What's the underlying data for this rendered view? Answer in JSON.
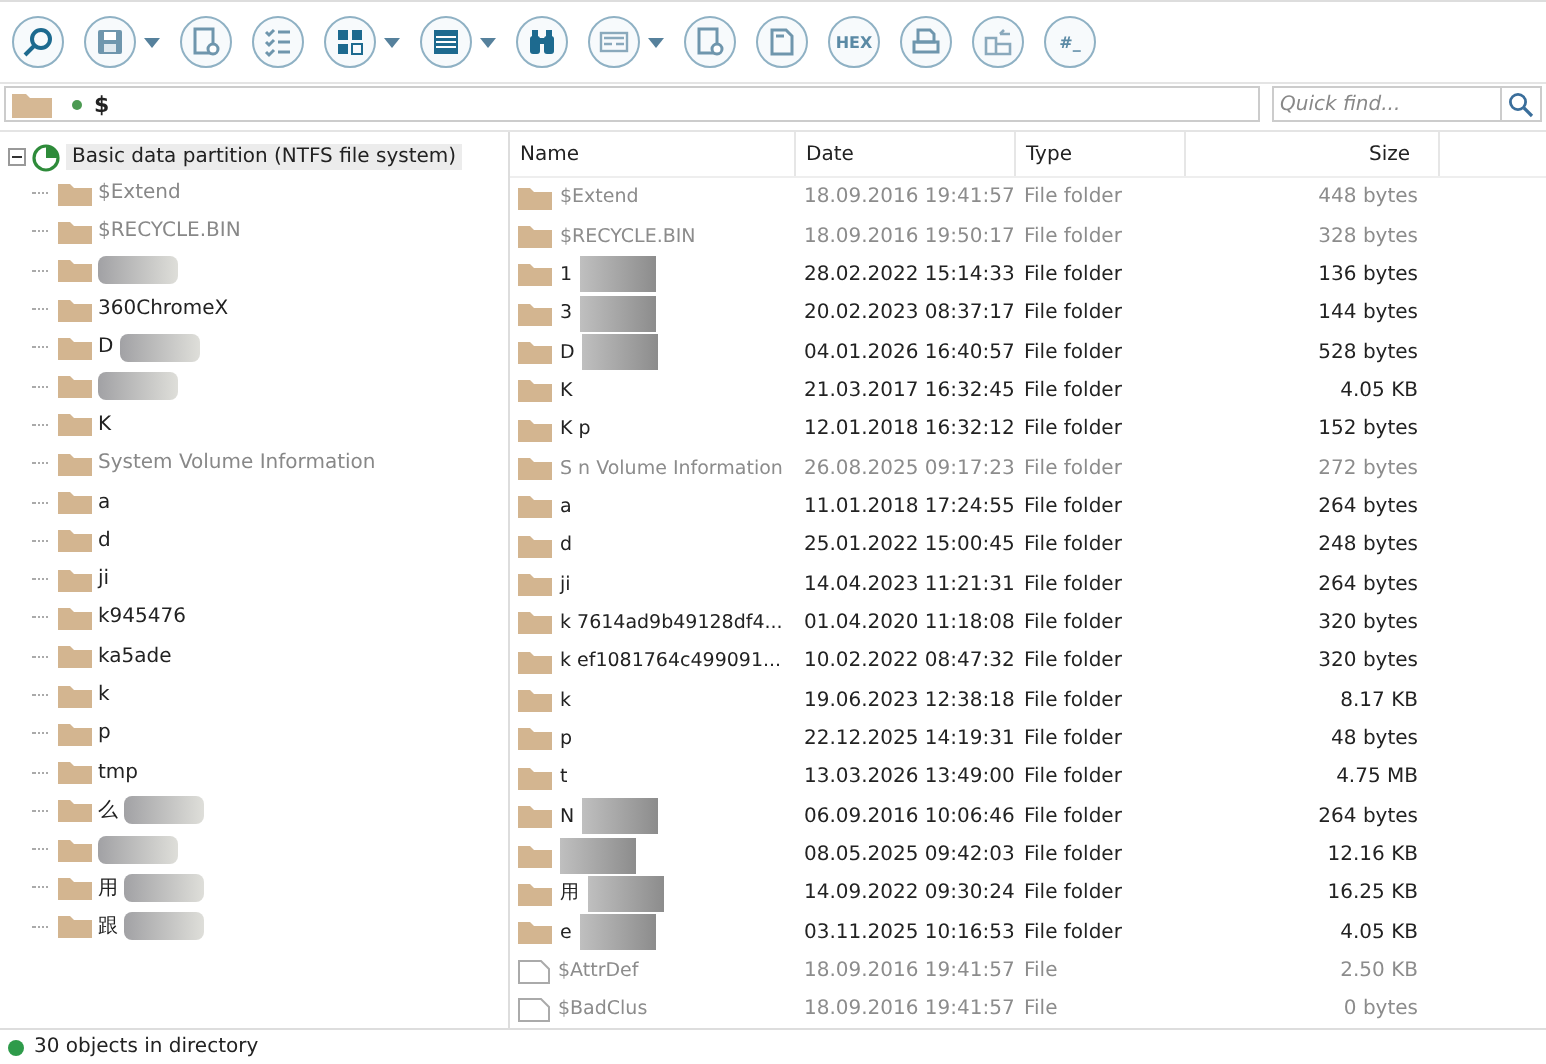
{
  "toolbar": [
    {
      "kind": "icon",
      "dropdown": false
    },
    {
      "kind": "icon",
      "dropdown": true
    },
    {
      "kind": "icon",
      "dropdown": false
    },
    {
      "kind": "icon",
      "dropdown": false
    },
    {
      "kind": "icon",
      "dropdown": true
    },
    {
      "kind": "icon",
      "dropdown": true
    },
    {
      "kind": "icon",
      "dropdown": false
    },
    {
      "kind": "icon",
      "dropdown": true
    },
    {
      "kind": "icon",
      "dropdown": false
    },
    {
      "kind": "icon",
      "dropdown": false
    },
    {
      "kind": "text",
      "label": "HEX",
      "dropdown": false
    },
    {
      "kind": "icon",
      "dropdown": false
    },
    {
      "kind": "icon",
      "dropdown": false
    },
    {
      "kind": "text",
      "label": "#_",
      "dropdown": false
    }
  ],
  "path": {
    "text": "$"
  },
  "quick_find": {
    "placeholder": "Quick find..."
  },
  "tree": {
    "root": "Basic data partition (NTFS file system)",
    "expanded": true,
    "children": [
      {
        "name": "$Extend",
        "dim": true,
        "redacted": false
      },
      {
        "name": "$RECYCLE.BIN",
        "dim": true,
        "redacted": false
      },
      {
        "redacted": true
      },
      {
        "name": "360ChromeX",
        "dim": false,
        "redacted": false
      },
      {
        "name": "D",
        "dim": false,
        "redacted": true
      },
      {
        "redacted": true
      },
      {
        "name": "K",
        "dim": false,
        "redacted": false
      },
      {
        "name": "System Volume Information",
        "dim": true,
        "redacted": false
      },
      {
        "name": "a",
        "dim": false,
        "redacted": false
      },
      {
        "name": "d",
        "dim": false,
        "redacted": false
      },
      {
        "name": "ji",
        "dim": false,
        "redacted": false
      },
      {
        "name": "k945476",
        "dim": false,
        "redacted": false
      },
      {
        "name": "ka5ade",
        "dim": false,
        "redacted": false
      },
      {
        "name": "k",
        "dim": false,
        "redacted": false
      },
      {
        "name": "p",
        "dim": false,
        "redacted": false
      },
      {
        "name": "tmp",
        "dim": false,
        "redacted": false
      },
      {
        "name": "么",
        "dim": false,
        "redacted": true
      },
      {
        "redacted": true
      },
      {
        "name": "用",
        "dim": false,
        "redacted": true
      },
      {
        "name": "跟",
        "dim": false,
        "redacted": true
      }
    ]
  },
  "table": {
    "columns": [
      "Name",
      "Date",
      "Type",
      "Size"
    ],
    "rows": [
      {
        "kind": "folder",
        "name": "$Extend",
        "date": "18.09.2016 19:41:57",
        "type": "File folder",
        "size": "448 bytes",
        "dim": true,
        "redacted": false
      },
      {
        "kind": "folder",
        "name": "$RECYCLE.BIN",
        "date": "18.09.2016 19:50:17",
        "type": "File folder",
        "size": "328 bytes",
        "dim": true,
        "redacted": false
      },
      {
        "kind": "folder",
        "name": "1",
        "date": "28.02.2022 15:14:33",
        "type": "File folder",
        "size": "136 bytes",
        "dim": false,
        "redacted": true
      },
      {
        "kind": "folder",
        "name": "3",
        "date": "20.02.2023 08:37:17",
        "type": "File folder",
        "size": "144 bytes",
        "dim": false,
        "redacted": true
      },
      {
        "kind": "folder",
        "name": "D",
        "date": "04.01.2026 16:40:57",
        "type": "File folder",
        "size": "528 bytes",
        "dim": false,
        "redacted": true
      },
      {
        "kind": "folder",
        "name": "K",
        "date": "21.03.2017 16:32:45",
        "type": "File folder",
        "size": "4.05 KB",
        "dim": false,
        "redacted": false
      },
      {
        "kind": "folder",
        "name": "K      p",
        "date": "12.01.2018 16:32:12",
        "type": "File folder",
        "size": "152 bytes",
        "dim": false,
        "redacted": false
      },
      {
        "kind": "folder",
        "name": "S      n Volume Information",
        "date": "26.08.2025 09:17:23",
        "type": "File folder",
        "size": "272 bytes",
        "dim": true,
        "redacted": false
      },
      {
        "kind": "folder",
        "name": "a",
        "date": "11.01.2018 17:24:55",
        "type": "File folder",
        "size": "264 bytes",
        "dim": false,
        "redacted": false
      },
      {
        "kind": "folder",
        "name": "d",
        "date": "25.01.2022 15:00:45",
        "type": "File folder",
        "size": "248 bytes",
        "dim": false,
        "redacted": false
      },
      {
        "kind": "folder",
        "name": "ji",
        "date": "14.04.2023 11:21:31",
        "type": "File folder",
        "size": "264 bytes",
        "dim": false,
        "redacted": false
      },
      {
        "kind": "folder",
        "name": "k          7614ad9b49128df4...",
        "date": "01.04.2020 11:18:08",
        "type": "File folder",
        "size": "320 bytes",
        "dim": false,
        "redacted": false
      },
      {
        "kind": "folder",
        "name": "k          ef1081764c499091...",
        "date": "10.02.2022 08:47:32",
        "type": "File folder",
        "size": "320 bytes",
        "dim": false,
        "redacted": false
      },
      {
        "kind": "folder",
        "name": "k",
        "date": "19.06.2023 12:38:18",
        "type": "File folder",
        "size": "8.17 KB",
        "dim": false,
        "redacted": false
      },
      {
        "kind": "folder",
        "name": "p",
        "date": "22.12.2025 14:19:31",
        "type": "File folder",
        "size": "48 bytes",
        "dim": false,
        "redacted": false
      },
      {
        "kind": "folder",
        "name": "t",
        "date": "13.03.2026 13:49:00",
        "type": "File folder",
        "size": "4.75 MB",
        "dim": false,
        "redacted": false
      },
      {
        "kind": "folder",
        "name": "N",
        "date": "06.09.2016 10:06:46",
        "type": "File folder",
        "size": "264 bytes",
        "dim": false,
        "redacted": true
      },
      {
        "kind": "folder",
        "date": "08.05.2025 09:42:03",
        "type": "File folder",
        "size": "12.16 KB",
        "dim": false,
        "redacted": true
      },
      {
        "kind": "folder",
        "name": "用",
        "date": "14.09.2022 09:30:24",
        "type": "File folder",
        "size": "16.25 KB",
        "dim": false,
        "redacted": true
      },
      {
        "kind": "folder",
        "name": "e",
        "date": "03.11.2025 10:16:53",
        "type": "File folder",
        "size": "4.05 KB",
        "dim": false,
        "redacted": true
      },
      {
        "kind": "file",
        "name": "$AttrDef",
        "date": "18.09.2016 19:41:57",
        "type": "File",
        "size": "2.50 KB",
        "dim": true,
        "redacted": false
      },
      {
        "kind": "file",
        "name": "$BadClus",
        "date": "18.09.2016 19:41:57",
        "type": "File",
        "size": "0 bytes",
        "dim": true,
        "redacted": false
      }
    ]
  },
  "status_bar": {
    "text": "30 objects in directory"
  }
}
